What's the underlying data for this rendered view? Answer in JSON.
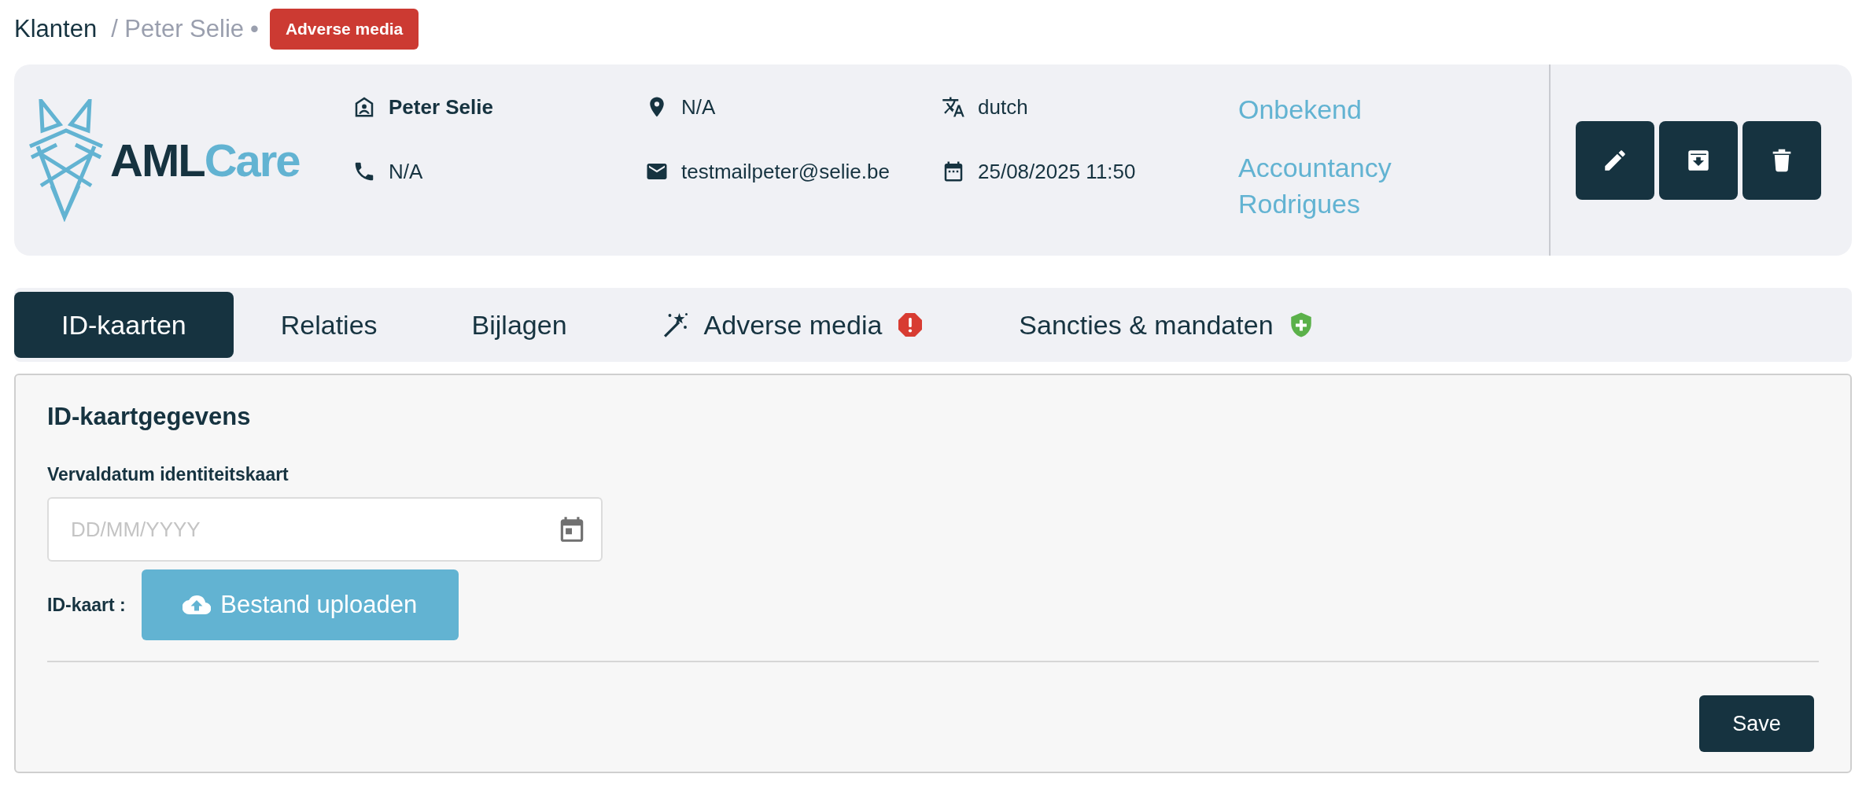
{
  "breadcrumb": {
    "root": "Klanten",
    "current": "/ Peter Selie",
    "separator": "•",
    "badge": "Adverse media"
  },
  "header": {
    "logo": {
      "part1": "AML",
      "part2": "Care"
    },
    "columns": [
      [
        {
          "kind": "person",
          "text": "Peter Selie"
        },
        {
          "kind": "phone",
          "text": "N/A"
        }
      ],
      [
        {
          "kind": "location",
          "text": "N/A"
        },
        {
          "kind": "email",
          "text": "testmailpeter@selie.be"
        }
      ],
      [
        {
          "kind": "language",
          "text": "dutch"
        },
        {
          "kind": "date",
          "text": "25/08/2025 11:50"
        }
      ]
    ],
    "links": [
      "Onbekend",
      "Accountancy Rodrigues"
    ],
    "actions": [
      {
        "kind": "edit"
      },
      {
        "kind": "archive"
      },
      {
        "kind": "delete"
      }
    ]
  },
  "tabs": [
    {
      "label": "ID-kaarten",
      "selected": true
    },
    {
      "label": "Relaties",
      "selected": false
    },
    {
      "label": "Bijlagen",
      "selected": false
    },
    {
      "label": "Adverse media",
      "selected": false,
      "kind": "adverse"
    },
    {
      "label": "Sancties & mandaten",
      "selected": false,
      "kind": "sanctions"
    }
  ],
  "form": {
    "title": "ID-kaartgegevens",
    "date_label": "Vervaldatum identiteitskaart",
    "date_placeholder": "DD/MM/YYYY",
    "file_label": "ID-kaart :",
    "upload_button": "Bestand uploaden",
    "save_button": "Save"
  }
}
